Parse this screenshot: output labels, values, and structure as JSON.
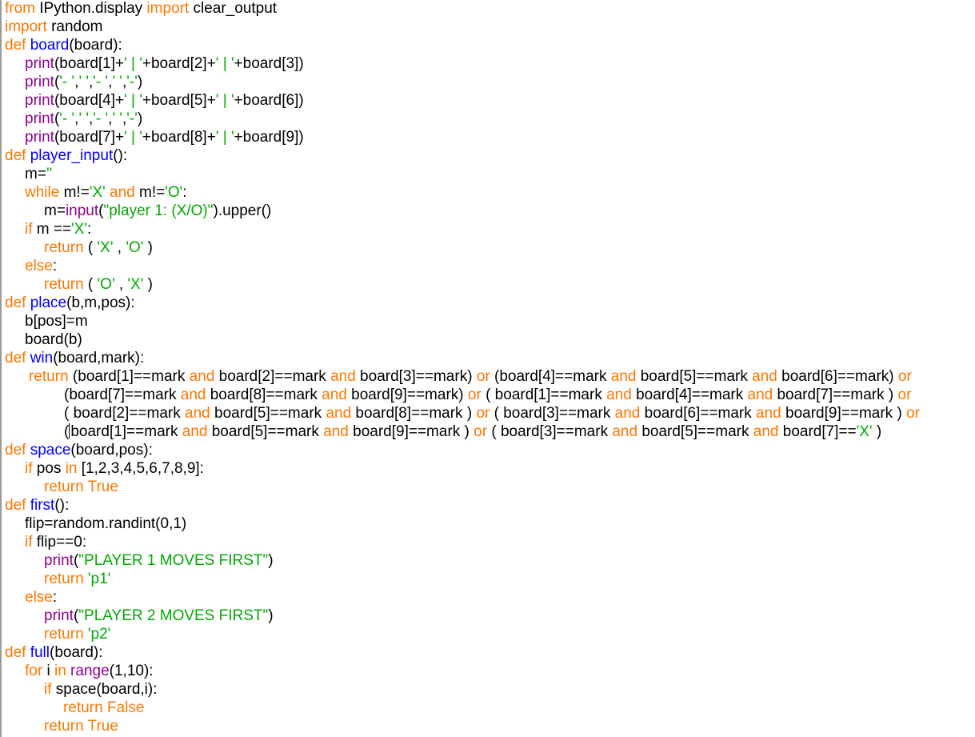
{
  "editor": {
    "colors": {
      "keyword": "#ff7700",
      "definition": "#0000ff",
      "builtin": "#900090",
      "string": "#00aa00",
      "text": "#000000",
      "background": "#ffffff"
    },
    "lines": [
      [
        [
          "kw",
          "from"
        ],
        [
          "t",
          " IPython.display "
        ],
        [
          "kw",
          "import"
        ],
        [
          "t",
          " clear_output"
        ]
      ],
      [
        [
          "kw",
          "import"
        ],
        [
          "t",
          " random"
        ]
      ],
      [
        [
          "kw",
          "def"
        ],
        [
          "t",
          " "
        ],
        [
          "fn",
          "board"
        ],
        [
          "t",
          "(board):"
        ]
      ],
      [
        [
          "bi",
          "print"
        ],
        [
          "t",
          "(board[1]+"
        ],
        [
          "st",
          "' | '"
        ],
        [
          "t",
          "+board[2]+"
        ],
        [
          "st",
          "' | '"
        ],
        [
          "t",
          "+board[3])"
        ]
      ],
      [
        [
          "bi",
          "print"
        ],
        [
          "t",
          "("
        ],
        [
          "st",
          "'- '"
        ],
        [
          "t",
          ","
        ],
        [
          "st",
          "' '"
        ],
        [
          "t",
          ","
        ],
        [
          "st",
          "'- '"
        ],
        [
          "t",
          ","
        ],
        [
          "st",
          "' '"
        ],
        [
          "t",
          ","
        ],
        [
          "st",
          "'-'"
        ],
        [
          "t",
          ")"
        ]
      ],
      [
        [
          "bi",
          "print"
        ],
        [
          "t",
          "(board[4]+"
        ],
        [
          "st",
          "' | '"
        ],
        [
          "t",
          "+board[5]+"
        ],
        [
          "st",
          "' | '"
        ],
        [
          "t",
          "+board[6])"
        ]
      ],
      [
        [
          "bi",
          "print"
        ],
        [
          "t",
          "("
        ],
        [
          "st",
          "'- '"
        ],
        [
          "t",
          ","
        ],
        [
          "st",
          "' '"
        ],
        [
          "t",
          ","
        ],
        [
          "st",
          "'- '"
        ],
        [
          "t",
          ","
        ],
        [
          "st",
          "' '"
        ],
        [
          "t",
          ","
        ],
        [
          "st",
          "'-'"
        ],
        [
          "t",
          ")"
        ]
      ],
      [
        [
          "bi",
          "print"
        ],
        [
          "t",
          "(board[7]+"
        ],
        [
          "st",
          "' | '"
        ],
        [
          "t",
          "+board[8]+"
        ],
        [
          "st",
          "' | '"
        ],
        [
          "t",
          "+board[9])"
        ]
      ],
      [
        [
          "kw",
          "def"
        ],
        [
          "t",
          " "
        ],
        [
          "fn",
          "player_input"
        ],
        [
          "t",
          "():"
        ]
      ],
      [
        [
          "t",
          "m="
        ],
        [
          "st",
          "''"
        ]
      ],
      [
        [
          "kw",
          "while"
        ],
        [
          "t",
          " m!="
        ],
        [
          "st",
          "'X'"
        ],
        [
          "t",
          " "
        ],
        [
          "kw",
          "and"
        ],
        [
          "t",
          " m!="
        ],
        [
          "st",
          "'O'"
        ],
        [
          "t",
          ":"
        ]
      ],
      [
        [
          "t",
          "m="
        ],
        [
          "bi",
          "input"
        ],
        [
          "t",
          "("
        ],
        [
          "st",
          "\"player 1: (X/O)\""
        ],
        [
          "t",
          ").upper()"
        ]
      ],
      [
        [
          "kw",
          "if"
        ],
        [
          "t",
          " m =="
        ],
        [
          "st",
          "'X'"
        ],
        [
          "t",
          ":"
        ]
      ],
      [
        [
          "kw",
          "return"
        ],
        [
          "t",
          " ( "
        ],
        [
          "st",
          "'X'"
        ],
        [
          "t",
          " , "
        ],
        [
          "st",
          "'O'"
        ],
        [
          "t",
          " )"
        ]
      ],
      [
        [
          "kw",
          "else"
        ],
        [
          "t",
          ":"
        ]
      ],
      [
        [
          "kw",
          "return"
        ],
        [
          "t",
          " ( "
        ],
        [
          "st",
          "'O'"
        ],
        [
          "t",
          " , "
        ],
        [
          "st",
          "'X'"
        ],
        [
          "t",
          " )"
        ]
      ],
      [
        [
          "kw",
          "def"
        ],
        [
          "t",
          " "
        ],
        [
          "fn",
          "place"
        ],
        [
          "t",
          "(b,m,pos):"
        ]
      ],
      [
        [
          "t",
          "b[pos]=m"
        ]
      ],
      [
        [
          "t",
          "board(b)"
        ]
      ],
      [
        [
          "kw",
          "def"
        ],
        [
          "t",
          " "
        ],
        [
          "fn",
          "win"
        ],
        [
          "t",
          "(board,mark):"
        ]
      ],
      [
        [
          "kw",
          "return"
        ],
        [
          "t",
          " (board[1]==mark "
        ],
        [
          "kw",
          "and"
        ],
        [
          "t",
          " board[2]==mark "
        ],
        [
          "kw",
          "and"
        ],
        [
          "t",
          " board[3]==mark) "
        ],
        [
          "kw",
          "or"
        ],
        [
          "t",
          " (board[4]==mark "
        ],
        [
          "kw",
          "and"
        ],
        [
          "t",
          " board[5]==mark "
        ],
        [
          "kw",
          "and"
        ],
        [
          "t",
          " board[6]==mark) "
        ],
        [
          "kw",
          "or"
        ]
      ],
      [
        [
          "t",
          "(board[7]==mark "
        ],
        [
          "kw",
          "and"
        ],
        [
          "t",
          " board[8]==mark "
        ],
        [
          "kw",
          "and"
        ],
        [
          "t",
          " board[9]==mark) "
        ],
        [
          "kw",
          "or"
        ],
        [
          "t",
          " ( board[1]==mark "
        ],
        [
          "kw",
          "and"
        ],
        [
          "t",
          " board[4]==mark "
        ],
        [
          "kw",
          "and"
        ],
        [
          "t",
          " board[7]==mark ) "
        ],
        [
          "kw",
          "or"
        ]
      ],
      [
        [
          "t",
          "( board[2]==mark "
        ],
        [
          "kw",
          "and"
        ],
        [
          "t",
          " board[5]==mark "
        ],
        [
          "kw",
          "and"
        ],
        [
          "t",
          " board[8]==mark ) "
        ],
        [
          "kw",
          "or"
        ],
        [
          "t",
          " ( board[3]==mark "
        ],
        [
          "kw",
          "and"
        ],
        [
          "t",
          " board[6]==mark "
        ],
        [
          "kw",
          "and"
        ],
        [
          "t",
          " board[9]==mark ) "
        ],
        [
          "kw",
          "or"
        ]
      ],
      [
        [
          "t",
          "("
        ],
        [
          "caret",
          ""
        ],
        [
          "t",
          "board[1]==mark "
        ],
        [
          "kw",
          "and"
        ],
        [
          "t",
          " board[5]==mark "
        ],
        [
          "kw",
          "and"
        ],
        [
          "t",
          " board[9]==mark ) "
        ],
        [
          "kw",
          "or"
        ],
        [
          "t",
          " ( board[3]==mark "
        ],
        [
          "kw",
          "and"
        ],
        [
          "t",
          " board[5]==mark "
        ],
        [
          "kw",
          "and"
        ],
        [
          "t",
          " board[7]=="
        ],
        [
          "st",
          "'X'"
        ],
        [
          "t",
          " )"
        ]
      ],
      [
        [
          "kw",
          "def"
        ],
        [
          "t",
          " "
        ],
        [
          "fn",
          "space"
        ],
        [
          "t",
          "(board,pos):"
        ]
      ],
      [
        [
          "kw",
          "if"
        ],
        [
          "t",
          " pos "
        ],
        [
          "kw",
          "in"
        ],
        [
          "t",
          " [1,2,3,4,5,6,7,8,9]:"
        ]
      ],
      [
        [
          "kw",
          "return"
        ],
        [
          "t",
          " "
        ],
        [
          "kw",
          "True"
        ]
      ],
      [
        [
          "kw",
          "def"
        ],
        [
          "t",
          " "
        ],
        [
          "fn",
          "first"
        ],
        [
          "t",
          "():"
        ]
      ],
      [
        [
          "t",
          "flip=random.randint(0,1)"
        ]
      ],
      [
        [
          "kw",
          "if"
        ],
        [
          "t",
          " flip==0:"
        ]
      ],
      [
        [
          "bi",
          "print"
        ],
        [
          "t",
          "("
        ],
        [
          "st",
          "\"PLAYER 1 MOVES FIRST\""
        ],
        [
          "t",
          ")"
        ]
      ],
      [
        [
          "kw",
          "return"
        ],
        [
          "t",
          " "
        ],
        [
          "st",
          "'p1'"
        ]
      ],
      [
        [
          "kw",
          "else"
        ],
        [
          "t",
          ":"
        ]
      ],
      [
        [
          "bi",
          "print"
        ],
        [
          "t",
          "("
        ],
        [
          "st",
          "\"PLAYER 2 MOVES FIRST\""
        ],
        [
          "t",
          ")"
        ]
      ],
      [
        [
          "kw",
          "return"
        ],
        [
          "t",
          " "
        ],
        [
          "st",
          "'p2'"
        ]
      ],
      [
        [
          "kw",
          "def"
        ],
        [
          "t",
          " "
        ],
        [
          "fn",
          "full"
        ],
        [
          "t",
          "(board):"
        ]
      ],
      [
        [
          "kw",
          "for"
        ],
        [
          "t",
          " i "
        ],
        [
          "kw",
          "in"
        ],
        [
          "t",
          " "
        ],
        [
          "bi",
          "range"
        ],
        [
          "t",
          "(1,10):"
        ]
      ],
      [
        [
          "kw",
          "if"
        ],
        [
          "t",
          " space(board,i):"
        ]
      ],
      [
        [
          "kw",
          "return"
        ],
        [
          "t",
          " "
        ],
        [
          "kw",
          "False"
        ]
      ],
      [
        [
          "kw",
          "return"
        ],
        [
          "t",
          " "
        ],
        [
          "kw",
          "True"
        ]
      ]
    ]
  }
}
